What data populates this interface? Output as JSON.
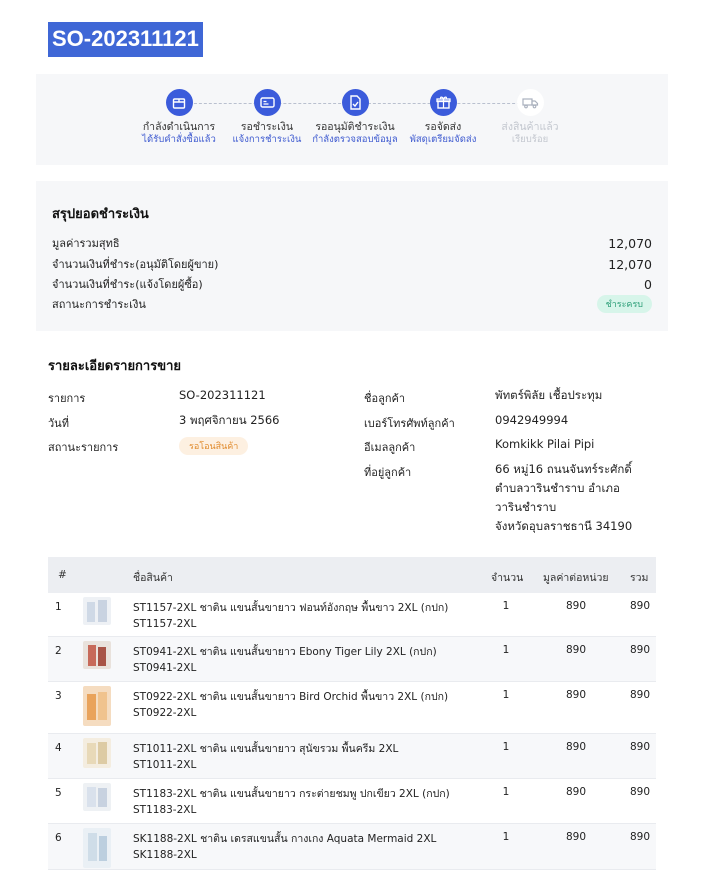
{
  "order_id": "SO-202311121",
  "steps": [
    {
      "label": "กำลังดำเนินการ",
      "sub": "ได้รับคำสั่งซื้อแล้ว",
      "icon": "box-icon",
      "active": true
    },
    {
      "label": "รอชำระเงิน",
      "sub": "แจ้งการชำระเงิน",
      "icon": "payment-card-icon",
      "active": true
    },
    {
      "label": "รออนุมัติชำระเงิน",
      "sub": "กำลังตรวจสอบข้อมูล",
      "icon": "document-check-icon",
      "active": true
    },
    {
      "label": "รอจัดส่ง",
      "sub": "พัสดุเตรียมจัดส่ง",
      "icon": "gift-box-icon",
      "active": true
    },
    {
      "label": "ส่งสินค้าแล้ว",
      "sub": "เรียบร้อย",
      "icon": "truck-icon",
      "active": false
    }
  ],
  "payment": {
    "title": "สรุปยอดชำระเงิน",
    "rows": [
      {
        "label": "มูลค่ารวมสุทธิ",
        "value": "12,070"
      },
      {
        "label": "จำนวนเงินที่ชำระ(อนุมัติโดยผู้ขาย)",
        "value": "12,070"
      },
      {
        "label": "จำนวนเงินที่ชำระ(แจ้งโดยผู้ซื้อ)",
        "value": "0"
      }
    ],
    "status_label": "สถานะการชำระเงิน",
    "status_badge": "ชำระครบ",
    "colors": {
      "badge_bg": "#d7f5ea",
      "badge_text": "#2a9d76"
    }
  },
  "details": {
    "title": "รายละเอียดรายการขาย",
    "order_label": "รายการ",
    "order_value": "SO-202311121",
    "date_label": "วันที่",
    "date_value": "3 พฤศจิกายน 2566",
    "status_label": "สถานะรายการ",
    "status_value": "รอโอนสินค้า",
    "customer_label": "ชื่อลูกค้า",
    "customer_value": "พัทตร์พิลัย เชื้อประทุม",
    "phone_label": "เบอร์โทรศัพท์ลูกค้า",
    "phone_value": "0942949994",
    "email_label": "อีเมลลูกค้า",
    "email_value": "Komkikk Pilai Pipi",
    "address_label": "ที่อยู่ลูกค้า",
    "address_lines": [
      "66 หมู่16 ถนนจันทร์ระศักดิ์",
      "ตำบลวารินชำราบ อำเภอ",
      "วารินชำราบ",
      "จังหวัดอุบลราชธานี 34190"
    ]
  },
  "table": {
    "headers": {
      "idx": "#",
      "name": "ชื่อสินค้า",
      "qty": "จำนวน",
      "unit": "มูลค่าต่อหน่วย",
      "total": "รวม"
    },
    "rows": [
      {
        "idx": "1",
        "name": "ST1157-2XL ชาติน แขนสั้นขายาว ฟอนท์อังกฤษ พื้นขาว 2XL (กปก)",
        "sku": "ST1157-2XL",
        "qty": "1",
        "unit": "890",
        "total": "890",
        "thumb": [
          "#cfd9e6",
          "#eef1f5"
        ]
      },
      {
        "idx": "2",
        "name": "ST0941-2XL ชาติน แขนสั้นขายาว Ebony Tiger Lily 2XL (กปก)",
        "sku": "ST0941-2XL",
        "qty": "1",
        "unit": "890",
        "total": "890",
        "thumb": [
          "#c76a5a",
          "#e9e2dc"
        ]
      },
      {
        "idx": "3",
        "name": "ST0922-2XL ชาติน แขนสั้นขายาว Bird Orchid พื้นขาว 2XL (กปก)",
        "sku": "ST0922-2XL",
        "qty": "1",
        "unit": "890",
        "total": "890",
        "thumb": [
          "#e9a35b",
          "#f5dcc0"
        ]
      },
      {
        "idx": "4",
        "name": "ST1011-2XL ชาติน แขนสั้นขายาว สุนัขรวม พื้นครีม 2XL",
        "sku": "ST1011-2XL",
        "qty": "1",
        "unit": "890",
        "total": "890",
        "thumb": [
          "#e8d9b8",
          "#f4ede0"
        ]
      },
      {
        "idx": "5",
        "name": "ST1183-2XL ชาติน แขนสั้นขายาว กระต่ายชมพู ปกเขียว 2XL (กปก)",
        "sku": "ST1183-2XL",
        "qty": "1",
        "unit": "890",
        "total": "890",
        "thumb": [
          "#d9e1ec",
          "#eef1f4"
        ]
      },
      {
        "idx": "6",
        "name": "SK1188-2XL ชาติน เดรสแขนสั้น กางเกง Aquata Mermaid 2XL",
        "sku": "SK1188-2XL",
        "qty": "1",
        "unit": "890",
        "total": "890",
        "thumb": [
          "#cfdde8",
          "#eaf0f5"
        ]
      }
    ]
  }
}
